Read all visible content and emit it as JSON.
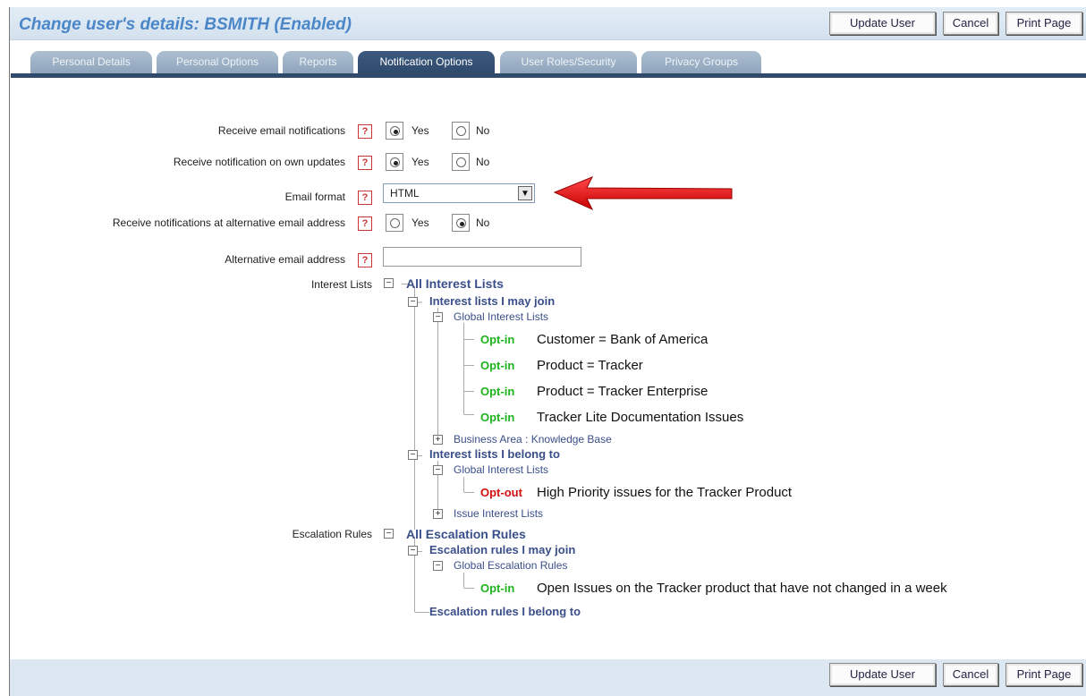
{
  "page": {
    "title": "Change user's details: BSMITH (Enabled)",
    "buttons": {
      "update": "Update User",
      "cancel": "Cancel",
      "print": "Print Page"
    }
  },
  "tabs": [
    {
      "label": "Personal Details"
    },
    {
      "label": "Personal Options"
    },
    {
      "label": "Reports"
    },
    {
      "label": "Notification Options"
    },
    {
      "label": "User Roles/Security"
    },
    {
      "label": "Privacy Groups"
    }
  ],
  "form": {
    "help_glyph": "?",
    "yes": "Yes",
    "no": "No",
    "receive_email": {
      "label": "Receive email notifications",
      "selected": "Yes"
    },
    "own_updates": {
      "label": "Receive notification on own updates",
      "selected": "Yes"
    },
    "email_format": {
      "label": "Email format",
      "value": "HTML"
    },
    "alt_notifications": {
      "label": "Receive notifications at alternative email address",
      "selected": "No"
    },
    "alt_email": {
      "label": "Alternative email address",
      "value": ""
    },
    "interest_lists_label": "Interest Lists",
    "escalation_rules_label": "Escalation Rules"
  },
  "tree": {
    "interest": {
      "root": "All Interest Lists",
      "may_join": "Interest lists I may join",
      "global1": "Global Interest Lists",
      "items": [
        {
          "status": "Opt-in",
          "text": "Customer = Bank of America"
        },
        {
          "status": "Opt-in",
          "text": "Product = Tracker"
        },
        {
          "status": "Opt-in",
          "text": "Product = Tracker Enterprise"
        },
        {
          "status": "Opt-in",
          "text": "Tracker Lite Documentation Issues"
        }
      ],
      "business_area": "Business Area : Knowledge Base",
      "belong_to": "Interest lists I belong to",
      "global2": "Global Interest Lists",
      "belong_item": {
        "status": "Opt-out",
        "text": "High Priority issues for the Tracker Product"
      },
      "issue_lists": "Issue Interest Lists"
    },
    "escalation": {
      "root": "All Escalation Rules",
      "may_join": "Escalation rules I may join",
      "global": "Global Escalation Rules",
      "item": {
        "status": "Opt-in",
        "text": "Open Issues on the Tracker product that have not changed in a week"
      },
      "belong_to": "Escalation rules I belong to"
    }
  },
  "colors": {
    "optin": "#1db31d",
    "optout": "#d41010",
    "accent": "#2f4a6b",
    "arrow": "#e01010"
  },
  "annotation": {
    "arrow_icon": "red-arrow-icon"
  }
}
